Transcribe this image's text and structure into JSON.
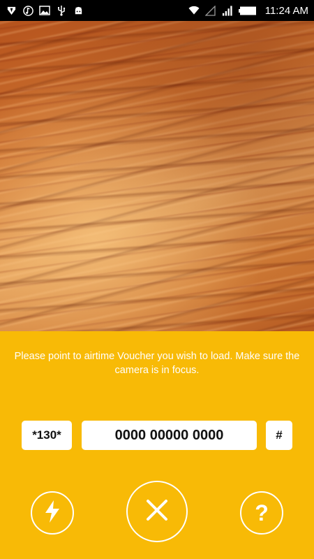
{
  "status_bar": {
    "time": "11:24 AM",
    "left_icons": [
      "app-icon",
      "music-icon",
      "image-icon",
      "usb-icon",
      "android-icon"
    ],
    "right_icons": [
      "wifi-icon",
      "signal-empty-icon",
      "signal-icon",
      "battery-icon"
    ]
  },
  "camera": {
    "icon": "camera-preview"
  },
  "panel": {
    "instructions": "Please point to airtime Voucher you wish to load. Make sure the camera is in focus.",
    "prefix": "*130*",
    "voucher_number": "0000 00000 0000",
    "suffix": "#",
    "help_label": "?",
    "colors": {
      "accent": "#f8ba06",
      "box": "#ffffff",
      "text": "#111111"
    },
    "buttons": {
      "flash_icon": "flash-icon",
      "cancel_icon": "close-icon",
      "help_icon": "question-icon"
    }
  }
}
